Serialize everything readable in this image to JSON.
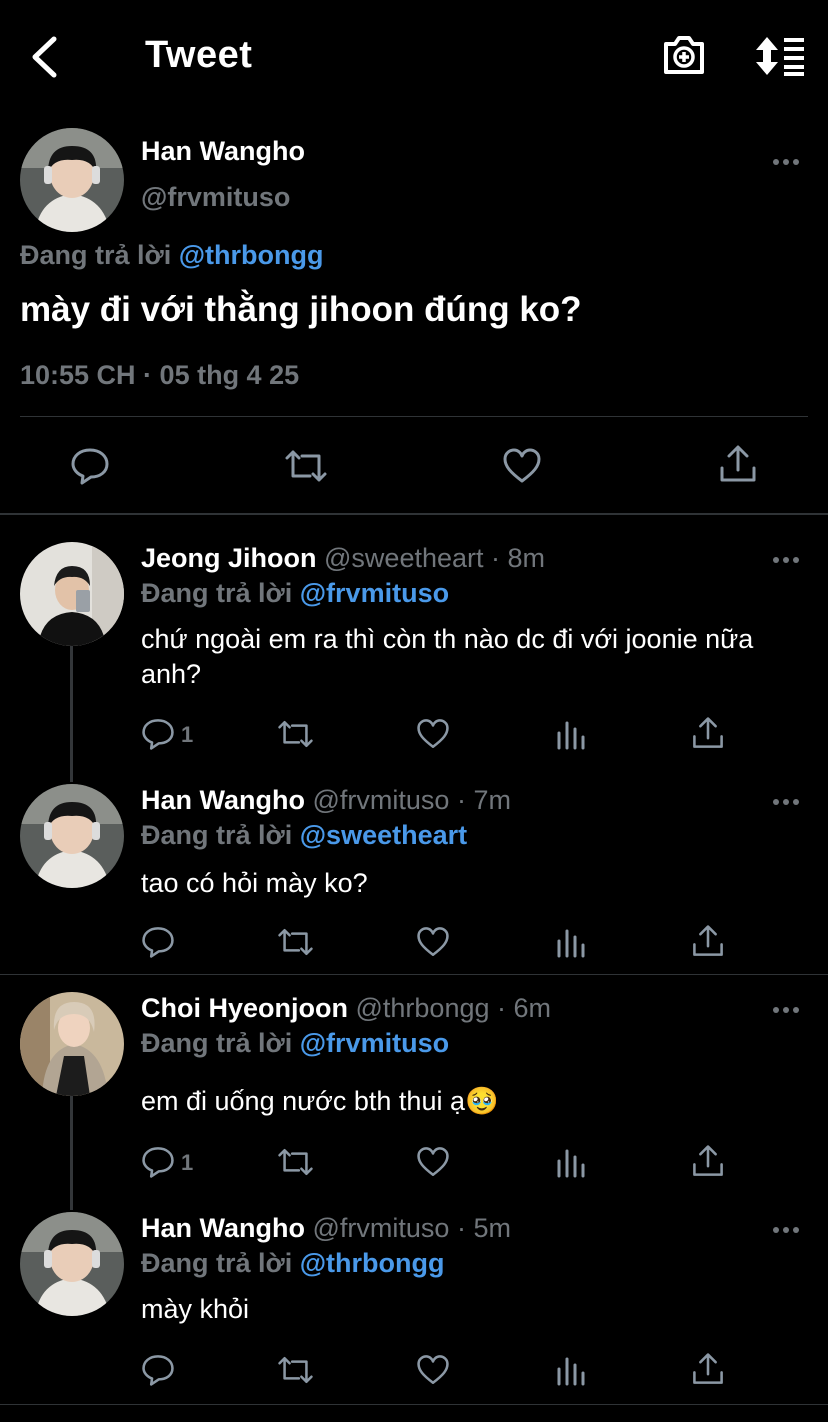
{
  "header": {
    "title": "Tweet"
  },
  "main_tweet": {
    "name": "Han Wangho",
    "handle": "@frvmituso",
    "replying_prefix": "Đang trả lời",
    "replying_to": "@thrbongg",
    "text": "mày đi với thằng jihoon đúng ko?",
    "timestamp": "10:55 CH · 05 thg 4 25"
  },
  "replies": [
    {
      "name": "Jeong Jihoon",
      "handle": "@sweetheart",
      "time": "· 8m",
      "replying_prefix": "Đang trả lời",
      "replying_to": "@frvmituso",
      "text": "chứ ngoài em ra thì còn th nào dc đi với joonie nữa anh?",
      "reply_count": "1"
    },
    {
      "name": "Han Wangho",
      "handle": "@frvmituso",
      "time": "· 7m",
      "replying_prefix": "Đang trả lời",
      "replying_to": "@sweetheart",
      "text": "tao có hỏi mày ko?",
      "reply_count": ""
    },
    {
      "name": "Choi Hyeonjoon",
      "handle": "@thrbongg",
      "time": "· 6m",
      "replying_prefix": "Đang trả lời",
      "replying_to": "@frvmituso",
      "text": "em đi uống nước bth thui ạ🥹",
      "reply_count": "1"
    },
    {
      "name": "Han Wangho",
      "handle": "@frvmituso",
      "time": "· 5m",
      "replying_prefix": "Đang trả lời",
      "replying_to": "@thrbongg",
      "text": "mày khỏi",
      "reply_count": ""
    }
  ],
  "colors": {
    "background": "#000000",
    "accent": "#4a99e9",
    "muted": "#71767b",
    "divider": "#2f3336"
  },
  "icons": [
    "back-arrow-icon",
    "camera-plus-icon",
    "sort-icon",
    "more-icon",
    "reply-icon",
    "retweet-icon",
    "like-icon",
    "analytics-icon",
    "share-icon"
  ]
}
